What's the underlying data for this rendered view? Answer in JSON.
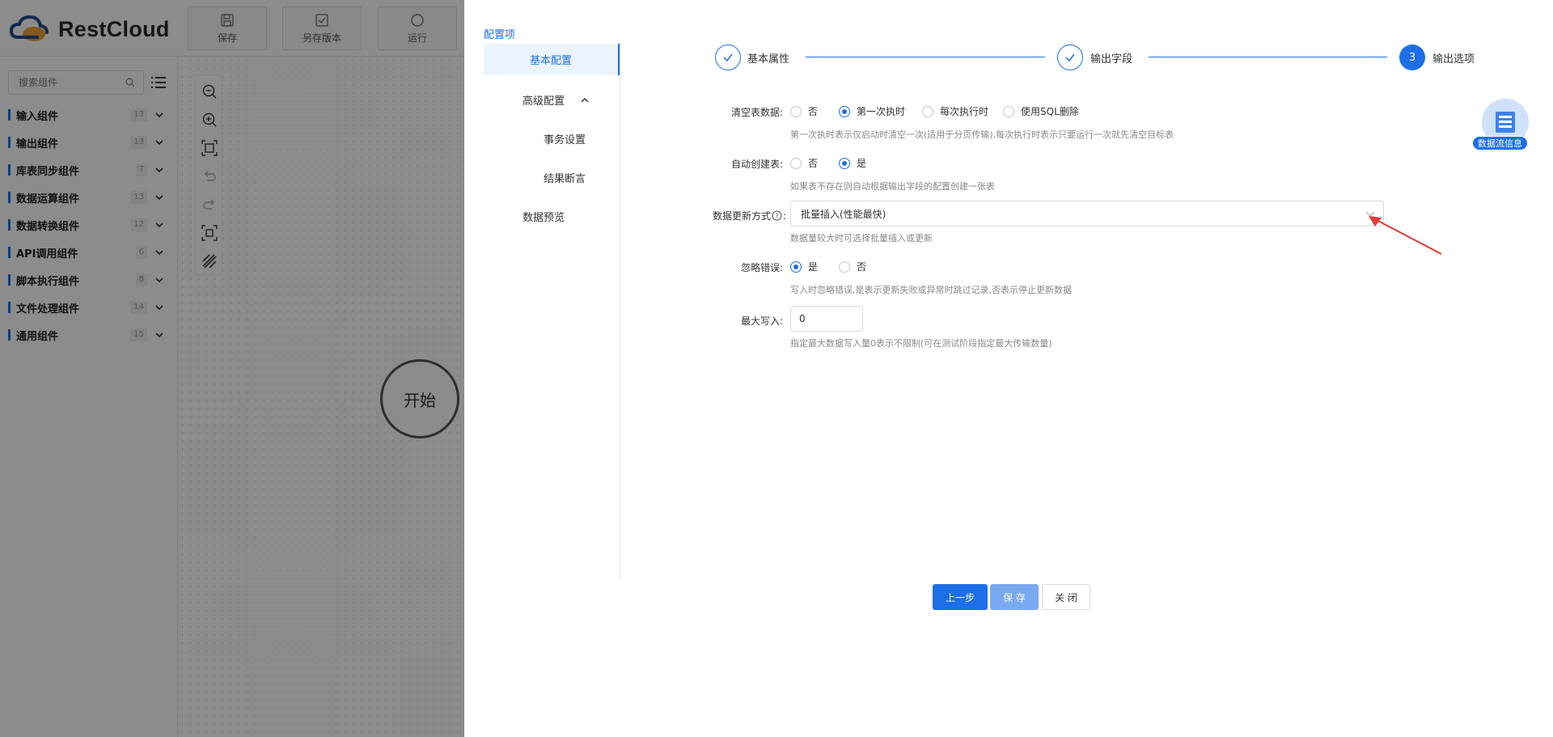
{
  "app": {
    "brand": "RestCloud",
    "toolbar": [
      {
        "label": "保存",
        "icon": "save-icon"
      },
      {
        "label": "另存版本",
        "icon": "save-version-icon"
      },
      {
        "label": "运行",
        "icon": "run-icon"
      }
    ],
    "search": {
      "placeholder": "搜索组件"
    },
    "categories": [
      {
        "label": "输入组件",
        "count": "13"
      },
      {
        "label": "输出组件",
        "count": "13"
      },
      {
        "label": "库表同步组件",
        "count": "7"
      },
      {
        "label": "数据运算组件",
        "count": "13"
      },
      {
        "label": "数据转换组件",
        "count": "12"
      },
      {
        "label": "API调用组件",
        "count": "6"
      },
      {
        "label": "脚本执行组件",
        "count": "8"
      },
      {
        "label": "文件处理组件",
        "count": "14"
      },
      {
        "label": "通用组件",
        "count": "15"
      }
    ],
    "start_node": "开始"
  },
  "drawer": {
    "title": "配置项",
    "menu": {
      "basic": "基本配置",
      "advanced": "高级配置",
      "transaction": "事务设置",
      "assertion": "结果断言",
      "preview": "数据预览"
    },
    "steps": [
      {
        "label": "基本属性",
        "state": "done"
      },
      {
        "label": "输出字段",
        "state": "done"
      },
      {
        "label": "输出选项",
        "state": "active",
        "number": "3"
      }
    ],
    "form": {
      "clear_table": {
        "label": "清空表数据:",
        "options": [
          "否",
          "第一次执时",
          "每次执行时",
          "使用SQL删除"
        ],
        "selected": 1,
        "hint": "第一次执时表示仅启动时清空一次(适用于分页传输),每次执行时表示只要运行一次就先清空目标表"
      },
      "auto_create": {
        "label": "自动创建表:",
        "options": [
          "否",
          "是"
        ],
        "selected": 1,
        "hint": "如果表不存在则自动根据输出字段的配置创建一张表"
      },
      "update_mode": {
        "label": "数据更新方式",
        "value": "批量插入(性能最快)",
        "hint": "数据量较大时可选择批量插入或更新"
      },
      "ignore_error": {
        "label": "忽略错误:",
        "options": [
          "是",
          "否"
        ],
        "selected": 0,
        "hint": "写入时忽略错误,是表示更新失败或异常时跳过记录,否表示停止更新数据"
      },
      "max_write": {
        "label": "最大写入:",
        "value": "0",
        "hint": "指定最大数据写入量0表示不限制(可在测试阶段指定最大传输数量)"
      }
    },
    "buttons": {
      "prev": "上一步",
      "save": "保 存",
      "close": "关 闭"
    },
    "flow_badge": "数据流信息",
    "colors": {
      "accent": "#1c6fe6",
      "annotation": "#e53935"
    }
  }
}
